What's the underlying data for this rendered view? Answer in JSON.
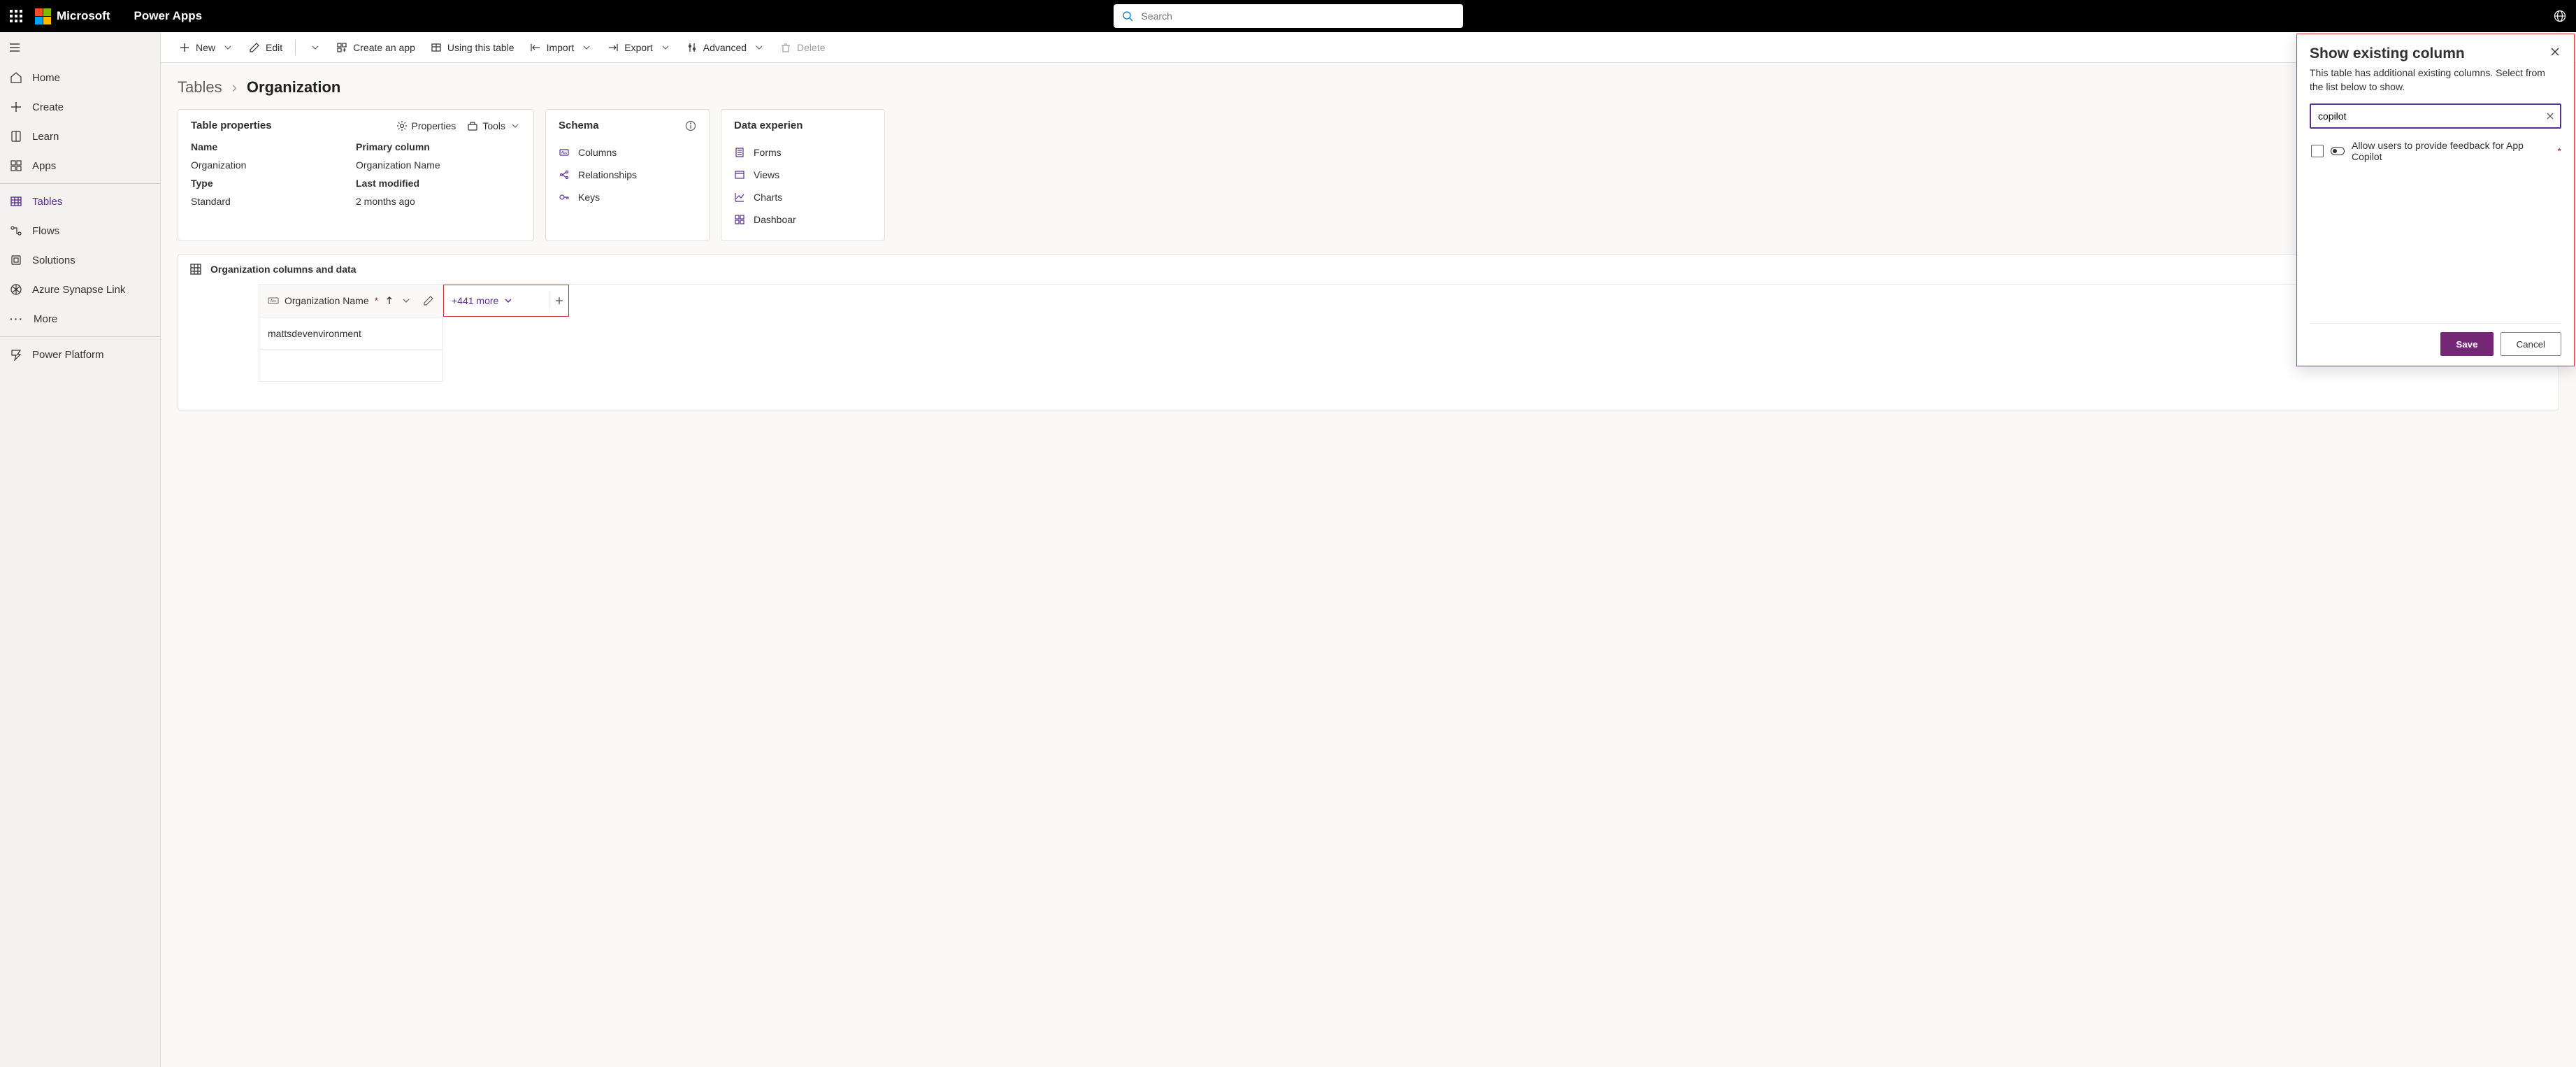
{
  "header": {
    "brand": "Microsoft",
    "app": "Power Apps",
    "search_placeholder": "Search"
  },
  "nav": {
    "items": [
      "Home",
      "Create",
      "Learn",
      "Apps",
      "Tables",
      "Flows",
      "Solutions",
      "Azure Synapse Link",
      "More",
      "Power Platform"
    ],
    "active_index": 4
  },
  "cmdbar": {
    "new": "New",
    "edit": "Edit",
    "create_app": "Create an app",
    "using_table": "Using this table",
    "import": "Import",
    "export": "Export",
    "advanced": "Advanced",
    "delete": "Delete"
  },
  "breadcrumb": {
    "root": "Tables",
    "leaf": "Organization"
  },
  "props_card": {
    "title": "Table properties",
    "act_properties": "Properties",
    "act_tools": "Tools",
    "name_l": "Name",
    "name_v": "Organization",
    "primary_l": "Primary column",
    "primary_v": "Organization Name",
    "type_l": "Type",
    "type_v": "Standard",
    "lastmod_l": "Last modified",
    "lastmod_v": "2 months ago"
  },
  "schema_card": {
    "title": "Schema",
    "columns": "Columns",
    "relationships": "Relationships",
    "keys": "Keys"
  },
  "dexp_card": {
    "title": "Data experiences",
    "forms": "Forms",
    "views": "Views",
    "charts": "Charts",
    "dashboards": "Dashboards"
  },
  "data_section": {
    "title": "Organization columns and data",
    "col1_label": "Organization Name",
    "more_label": "+441 more",
    "row1": "mattsdevenvironment"
  },
  "flyout": {
    "title": "Show existing column",
    "subtitle": "This table has additional existing columns. Select from the list below to show.",
    "search_value": "copilot",
    "result_label": "Allow users to provide feedback for App Copilot",
    "save": "Save",
    "cancel": "Cancel"
  }
}
